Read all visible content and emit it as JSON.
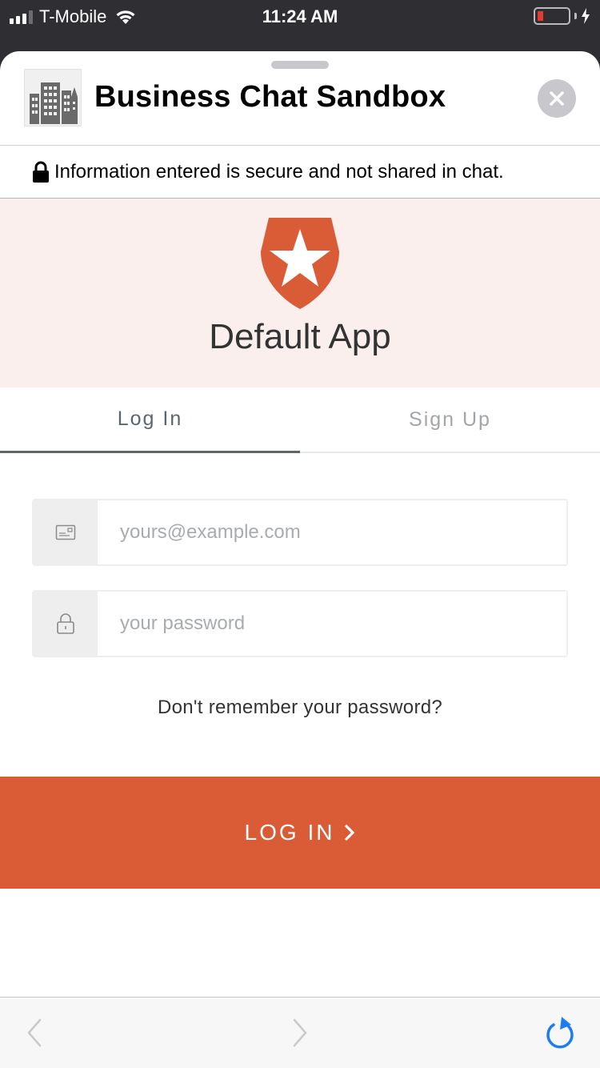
{
  "status_bar": {
    "carrier": "T-Mobile",
    "time": "11:24 AM",
    "signal_bars_active": 3,
    "signal_bars_total": 4,
    "battery_level": 0.1,
    "charging": true
  },
  "sheet": {
    "title": "Business Chat Sandbox",
    "close_icon": "close-icon",
    "logo_icon": "building-icon"
  },
  "secure_notice": {
    "icon": "lock-icon",
    "text": "Information entered is secure and not shared in chat."
  },
  "hero": {
    "logo_icon": "shield-star-icon",
    "app_name": "Default App",
    "accent_color": "#d95c37",
    "background_color": "#faefed"
  },
  "tabs": [
    {
      "label": "Log In",
      "active": true
    },
    {
      "label": "Sign Up",
      "active": false
    }
  ],
  "form": {
    "email_placeholder": "yours@example.com",
    "email_value": "",
    "password_placeholder": "your password",
    "password_value": "",
    "forgot_link": "Don't remember your password?",
    "submit_label": "LOG IN"
  },
  "browser_toolbar": {
    "back_icon": "chevron-left-icon",
    "forward_icon": "chevron-right-icon",
    "reload_icon": "reload-icon",
    "reload_color": "#1e7cf2"
  }
}
